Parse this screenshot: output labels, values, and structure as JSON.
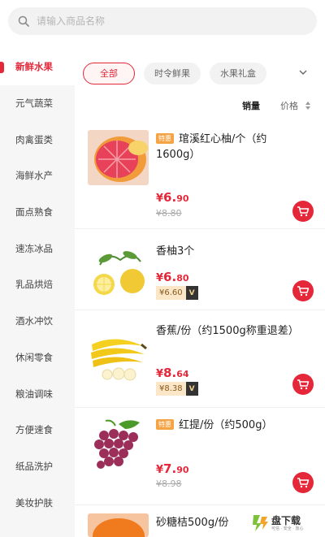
{
  "search": {
    "placeholder": "请输入商品名称"
  },
  "sidebar": {
    "items": [
      {
        "label": "新鲜水果",
        "active": true
      },
      {
        "label": "元气蔬菜"
      },
      {
        "label": "肉禽蛋类"
      },
      {
        "label": "海鲜水产"
      },
      {
        "label": "面点熟食"
      },
      {
        "label": "速冻冰品"
      },
      {
        "label": "乳品烘焙"
      },
      {
        "label": "酒水冲饮"
      },
      {
        "label": "休闲零食"
      },
      {
        "label": "粮油调味"
      },
      {
        "label": "方便速食"
      },
      {
        "label": "纸品洗护"
      },
      {
        "label": "美妆护肤"
      }
    ]
  },
  "tabs": [
    {
      "label": "全部",
      "active": true
    },
    {
      "label": "时令鲜果"
    },
    {
      "label": "水果礼盒"
    }
  ],
  "sort": {
    "sales_label": "销量",
    "price_label": "价格"
  },
  "products": [
    {
      "tag": "特惠",
      "name": "琯溪红心柚/个（约1600g）",
      "price_currency": "¥",
      "price_main": "6.",
      "price_tail": "90",
      "original_price": "¥8.80"
    },
    {
      "name": "香柚3个",
      "price_currency": "¥",
      "price_main": "6.",
      "price_tail": "80",
      "vip_price": "¥6.60",
      "vip_badge": "V"
    },
    {
      "name": "香蕉/份（约1500g称重退差）",
      "price_currency": "¥",
      "price_main": "8.",
      "price_tail": "64",
      "vip_price": "¥8.38",
      "vip_badge": "V"
    },
    {
      "tag": "特惠",
      "name": "红提/份（约500g）",
      "price_currency": "¥",
      "price_main": "7.",
      "price_tail": "90",
      "original_price": "¥8.98"
    },
    {
      "name": "砂糖桔500g/份"
    }
  ],
  "watermark": {
    "text": "盘下载",
    "sub": "可信 · 安全 · 放心"
  },
  "colors": {
    "accent": "#e4283a",
    "tag": "#f5a344",
    "vip_bg": "#fbe6c7"
  }
}
